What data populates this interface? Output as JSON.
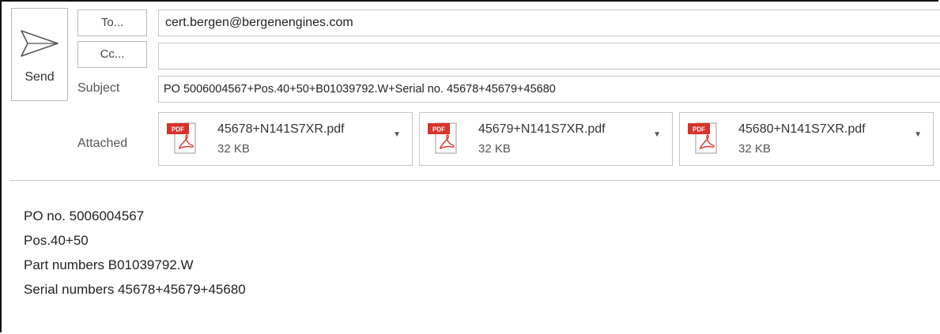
{
  "send": {
    "label": "Send",
    "access_key": "S"
  },
  "to": {
    "button_label": "To...",
    "value": "cert.bergen@bergenengines.com"
  },
  "cc": {
    "button_label": "Cc...",
    "value": ""
  },
  "subject": {
    "label": "Subject",
    "value": "PO 5006004567+Pos.40+50+B01039792.W+Serial no. 45678+45679+45680"
  },
  "attached": {
    "label": "Attached",
    "files": [
      {
        "name": "45678+N141S7XR.pdf",
        "size": "32 KB",
        "icon": "pdf-icon"
      },
      {
        "name": "45679+N141S7XR.pdf",
        "size": "32 KB",
        "icon": "pdf-icon"
      },
      {
        "name": "45680+N141S7XR.pdf",
        "size": "32 KB",
        "icon": "pdf-icon"
      }
    ]
  },
  "body": {
    "lines": [
      "PO no. 5006004567",
      "Pos.40+50",
      "Part numbers B01039792.W",
      "Serial numbers 45678+45679+45680"
    ]
  },
  "colors": {
    "pdf_red": "#d9322b",
    "border": "#c6c6c6"
  }
}
